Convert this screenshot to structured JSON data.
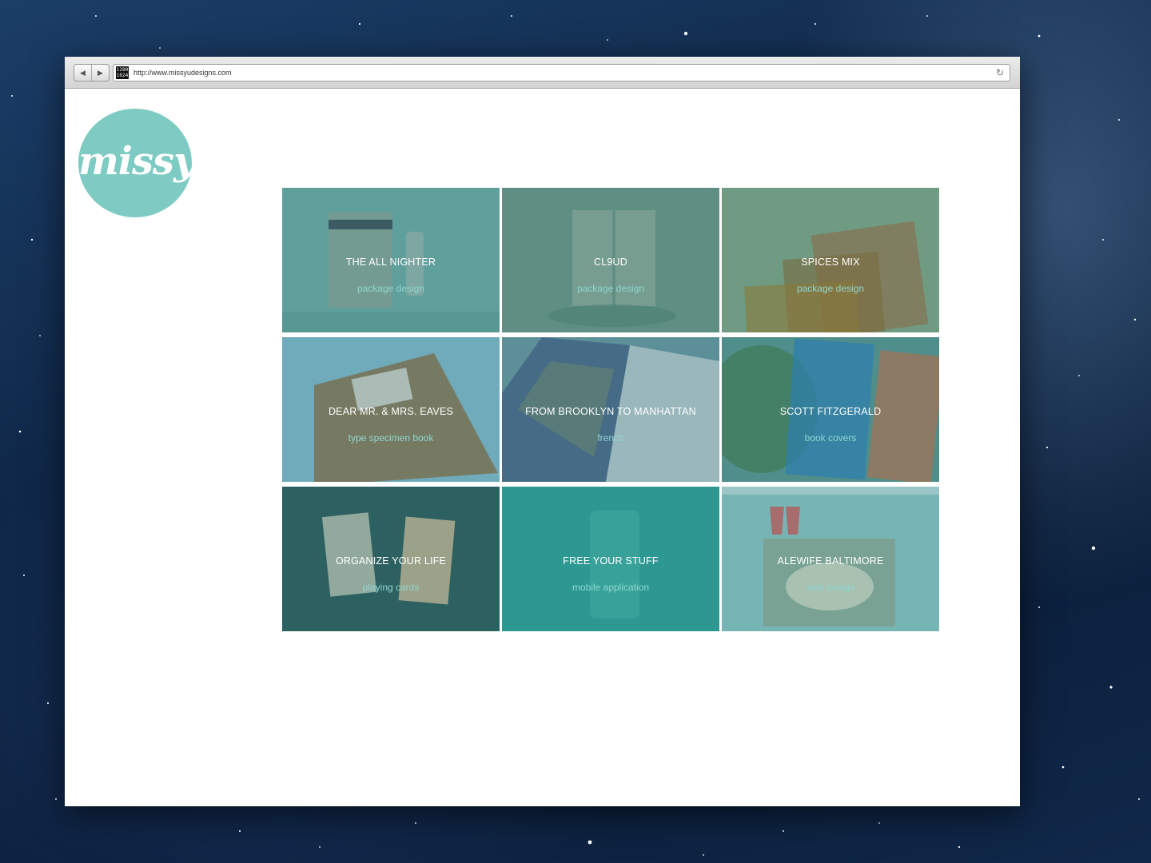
{
  "browser": {
    "url": "http://www.missyudesigns.com",
    "favicon_text": [
      "1280",
      "1024"
    ]
  },
  "logo": {
    "text": "missyu"
  },
  "projects": [
    {
      "title": "THE ALL NIGHTER",
      "category": "package design",
      "color": "#5f9f9c"
    },
    {
      "title": "CL9UD",
      "category": "package design",
      "color": "#5e8f82"
    },
    {
      "title": "SPICES MIX",
      "category": "package design",
      "color": "#6f9b83"
    },
    {
      "title": "DEAR MR. & MRS. EAVES",
      "category": "type specimen book",
      "color": "#6fabbb"
    },
    {
      "title": "FROM BROOKLYN TO MANHATTAN",
      "category": "french",
      "color": "#5d8f98"
    },
    {
      "title": "SCOTT FITZGERALD",
      "category": "book covers",
      "color": "#4f8e8a"
    },
    {
      "title": "ORGANIZE YOUR LIFE",
      "category": "playing cards",
      "color": "#2d6061"
    },
    {
      "title": "FREE YOUR STUFF",
      "category": "mobile application",
      "color": "#2d9892"
    },
    {
      "title": "ALEWIFE BALTIMORE",
      "category": "web design",
      "color": "#77b5b4"
    }
  ]
}
